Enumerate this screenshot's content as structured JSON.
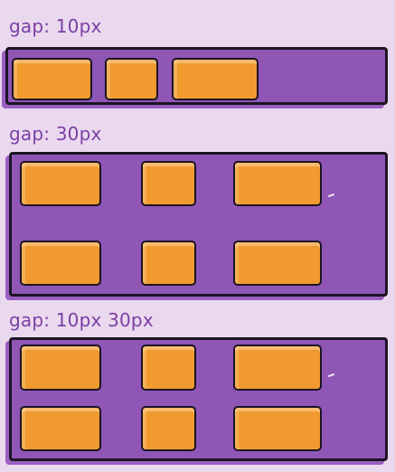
{
  "sections": [
    {
      "label": "gap: 10px"
    },
    {
      "label": "gap: 30px"
    },
    {
      "label": "gap: 10px 30px"
    }
  ],
  "colors": {
    "background": "#ead9ee",
    "label_text": "#7a3fa6",
    "container": "#8f56b6",
    "item": "#f09a2f",
    "outline": "#1c1423"
  }
}
